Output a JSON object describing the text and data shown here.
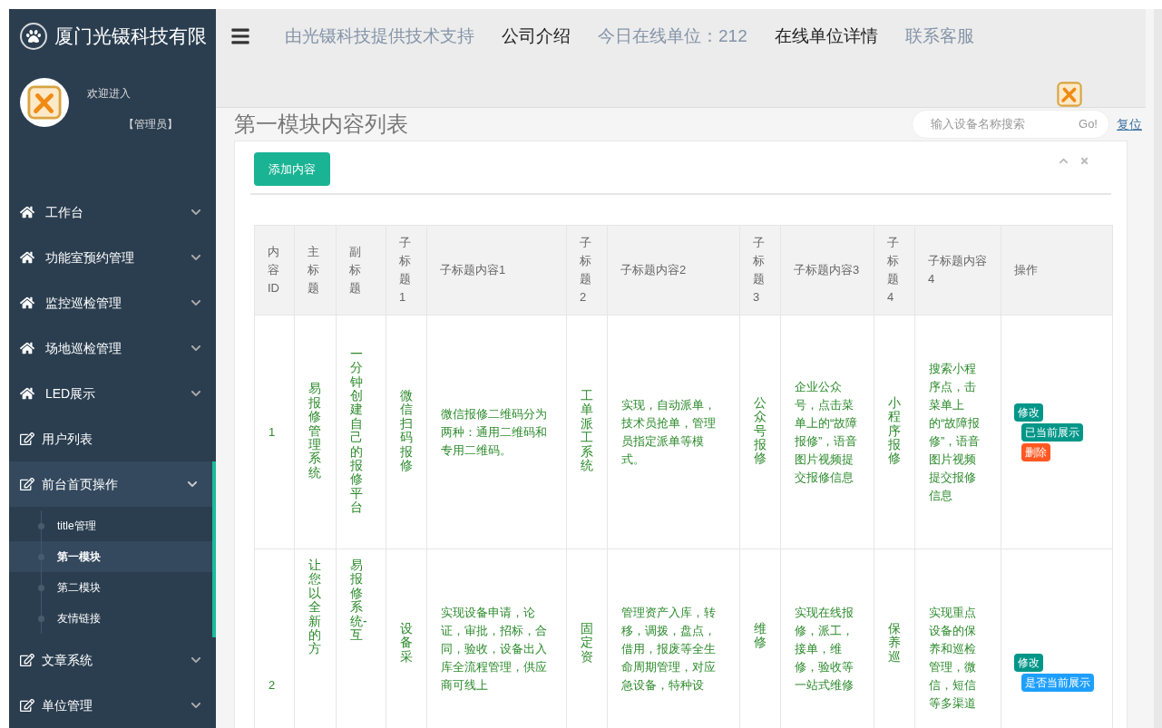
{
  "brand": {
    "name": "厦门光镊科技有限"
  },
  "user": {
    "greeting": "欢迎进入",
    "role": "【管理员】"
  },
  "topnav": [
    {
      "label": "由光镊科技提供技术支持",
      "kind": "muted"
    },
    {
      "label": "公司介绍",
      "kind": "strong"
    },
    {
      "label": "今日在线单位：212",
      "kind": "muted"
    },
    {
      "label": "在线单位详情",
      "kind": "strong"
    },
    {
      "label": "联系客服",
      "kind": "muted"
    }
  ],
  "sidebar": {
    "items": [
      {
        "label": "工作台",
        "kind": "home",
        "expandable": true,
        "expanded": false
      },
      {
        "label": "功能室预约管理",
        "kind": "home",
        "expandable": true,
        "expanded": false
      },
      {
        "label": "监控巡检管理",
        "kind": "home",
        "expandable": true,
        "expanded": false
      },
      {
        "label": "场地巡检管理",
        "kind": "home",
        "expandable": true,
        "expanded": false
      },
      {
        "label": "LED展示",
        "kind": "home",
        "expandable": true,
        "expanded": false
      },
      {
        "label": "用户列表",
        "kind": "edit",
        "expandable": false,
        "expanded": false
      },
      {
        "label": "前台首页操作",
        "kind": "edit",
        "expandable": true,
        "expanded": true,
        "children": [
          {
            "label": "title管理",
            "selected": false
          },
          {
            "label": "第一模块",
            "selected": true
          },
          {
            "label": "第二模块",
            "selected": false
          },
          {
            "label": "友情链接",
            "selected": false
          }
        ]
      },
      {
        "label": "文章系统",
        "kind": "edit",
        "expandable": true,
        "expanded": false
      },
      {
        "label": "单位管理",
        "kind": "edit",
        "expandable": true,
        "expanded": false
      }
    ]
  },
  "page": {
    "title": "第一模块内容列表",
    "search": {
      "placeholder": "输入设备名称搜索",
      "button": "Go!"
    },
    "reset": "复位",
    "add_button": "添加内容"
  },
  "table": {
    "columns": [
      {
        "label": "内容ID",
        "narrow": true
      },
      {
        "label": "主标题",
        "narrow": true
      },
      {
        "label": "副标题",
        "narrow": true
      },
      {
        "label": "子标题1",
        "narrow": true
      },
      {
        "label": "子标题内容1",
        "narrow": false
      },
      {
        "label": "子标题2",
        "narrow": true
      },
      {
        "label": "子标题内容2",
        "narrow": false
      },
      {
        "label": "子标题3",
        "narrow": true
      },
      {
        "label": "子标题内容3",
        "narrow": false
      },
      {
        "label": "子标题4",
        "narrow": true
      },
      {
        "label": "子标题内容4",
        "narrow": false
      },
      {
        "label": "操作",
        "narrow": false
      }
    ],
    "rows": [
      {
        "cells": [
          "1",
          "易报修管理系统",
          "一分钟创建自己的报修平台",
          "微信扫码报修",
          "微信报修二维码分为两种：通用二维码和专用二维码。",
          "工单派工系统",
          "实现，自动派单，技术员抢单，管理员指定派单等模式。",
          "公众号报修",
          "企业公众号，点击菜单上的“故障报修”，语音图片视频提交报修信息",
          "小程序报修",
          "搜索小程序点，击菜单上的“故障报修”，语音图片视频提交报修信息"
        ],
        "actions": [
          {
            "label": "修改",
            "kind": "edit"
          },
          {
            "label": "已当前展示",
            "kind": "shown"
          },
          {
            "label": "删除",
            "kind": "delete"
          }
        ]
      },
      {
        "cells": [
          "2",
          "让您以全新的方",
          "易报修系统-互",
          "设备采",
          "实现设备申请，论证，审批，招标，合同，验收，设备出入库全流程管理，供应商可线上",
          "固定资",
          "管理资产入库，转移，调拨，盘点，借用，报废等全生命周期管理，对应急设备，特种设",
          "维修",
          "实现在线报修，派工，接单，维修，验收等一站式维修",
          "保养巡",
          "实现重点设备的保养和巡检管理，微信，短信等多渠道"
        ],
        "actions": [
          {
            "label": "修改",
            "kind": "edit"
          },
          {
            "label": "是否当前展示",
            "kind": "toggle"
          }
        ]
      }
    ]
  }
}
